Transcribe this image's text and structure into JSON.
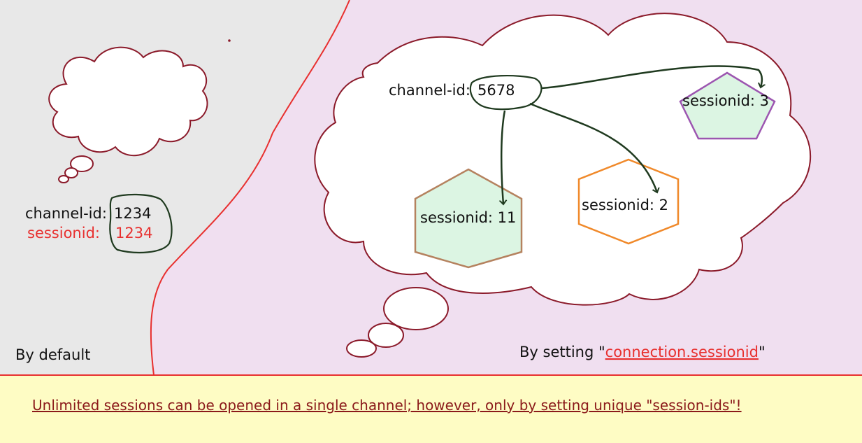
{
  "colors": {
    "left_panel_bg": "#e8e8e8",
    "right_panel_bg": "#f0dff0",
    "banner_bg": "#fefcc4",
    "divider_red": "#e8302f",
    "cloud_outline": "#8b1a2a",
    "loop_green": "#1f3a1f",
    "shape_fill": "#dcf5e3",
    "hexagon_left_stroke": "#b5825f",
    "hexagon_right_stroke": "#f0892a",
    "hexagon_right_fill": "#ffffff",
    "pentagon_stroke": "#9c55b0",
    "link_red": "#e8302f",
    "banner_text": "#8b1a1a"
  },
  "left": {
    "channel_label": "channel-id:",
    "channel_value": "1234",
    "session_label": "sessionid:",
    "session_value": "1234",
    "caption": "By default"
  },
  "right": {
    "channel_label": "channel-id:",
    "channel_value": "5678",
    "sessions": [
      "sessionid: 11",
      "sessionid: 2",
      "sessionid: 3"
    ],
    "caption_prefix": "By setting \"",
    "caption_link": "connection.sessionid",
    "caption_suffix": "\""
  },
  "banner": {
    "text": "Unlimited sessions can be opened in a single channel; however, only by setting unique \"session-ids\"!"
  }
}
